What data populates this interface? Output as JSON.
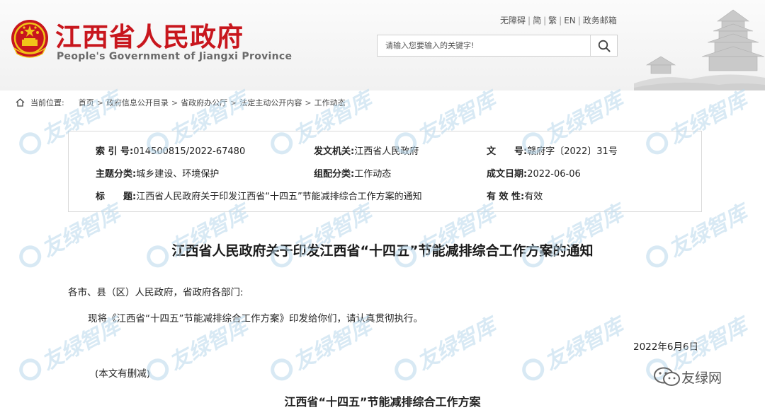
{
  "header": {
    "site_title": "江西省人民政府",
    "site_subtitle": "People's Government of Jiangxi Province",
    "links": [
      "无障碍",
      "简",
      "繁",
      "EN",
      "政务邮箱"
    ],
    "search_placeholder": "请输入您要输入的关键字!"
  },
  "breadcrumb": {
    "label": "当前位置:",
    "items": [
      "首页",
      "政府信息公开目录",
      "省政府办公厅",
      "法定主动公开内容",
      "工作动态"
    ]
  },
  "meta": {
    "index_key": "索 引 号:",
    "index_val": "014500815/2022-67480",
    "issuer_key": "发文机关:",
    "issuer_val": "江西省人民政府",
    "docno_key": "文　　号:",
    "docno_val": "赣府字〔2022〕31号",
    "topic_key": "主题分类:",
    "topic_val": "城乡建设、环境保护",
    "genre_key": "组配分类:",
    "genre_val": "工作动态",
    "date_key": "成文日期:",
    "date_val": "2022-06-06",
    "title_key": "标　　题:",
    "title_val": "江西省人民政府关于印发江西省“十四五”节能减排综合工作方案的通知",
    "validity_key": "有 效 性:",
    "validity_val": "有效"
  },
  "document": {
    "title": "江西省人民政府关于印发江西省“十四五”节能减排综合工作方案的通知",
    "salutation": "各市、县（区）人民政府，省政府各部门:",
    "body": "现将《江西省“十四五”节能减排综合工作方案》印发给你们，请认真贯彻执行。",
    "date": "2022年6月6日",
    "note": "(本文有删减)",
    "subtitle": "江西省“十四五”节能减排综合工作方案"
  },
  "watermark": {
    "text": "友绿智库",
    "corner_text": "友绿网"
  },
  "colors": {
    "brand_red": "#c8161d",
    "watermark": "#b9d8ec"
  }
}
